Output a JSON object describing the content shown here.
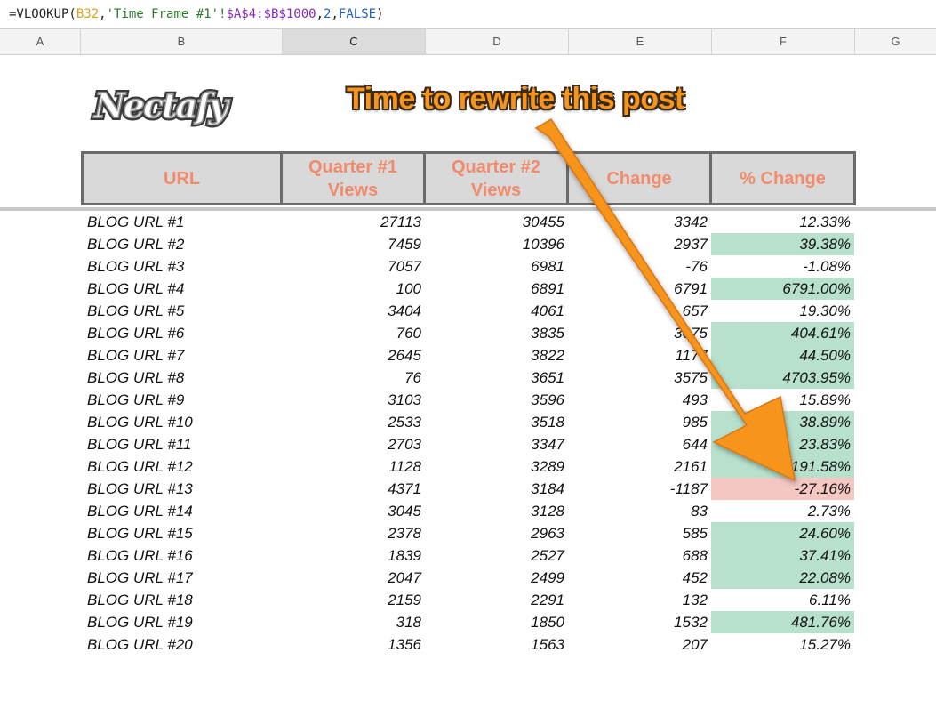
{
  "formula": {
    "prefix": "=VLOOKUP(",
    "ref": "B32",
    "comma1": ",",
    "sheet": "'Time Frame #1'!",
    "range": "$A$4:$B$1000",
    "comma2": ",",
    "index": "2",
    "comma3": ",",
    "flag": "FALSE",
    "suffix": ")"
  },
  "columns": [
    "A",
    "B",
    "C",
    "D",
    "E",
    "F",
    "G"
  ],
  "logo_text": "Nectafy",
  "annotation": "Time to rewrite this post",
  "colors": {
    "header_text": "#f28b6c",
    "positive": "#b7e1cd",
    "negative": "#f4c7c3",
    "arrow": "#f7941d"
  },
  "table": {
    "headers": [
      "URL",
      "Quarter #1 Views",
      "Quarter #2 Views",
      "Change",
      "% Change"
    ],
    "rows": [
      {
        "url": "BLOG URL #1",
        "q1": "27113",
        "q2": "30455",
        "change": "3342",
        "pct": "12.33%",
        "status": "none"
      },
      {
        "url": "BLOG URL #2",
        "q1": "7459",
        "q2": "10396",
        "change": "2937",
        "pct": "39.38%",
        "status": "positive"
      },
      {
        "url": "BLOG URL #3",
        "q1": "7057",
        "q2": "6981",
        "change": "-76",
        "pct": "-1.08%",
        "status": "none"
      },
      {
        "url": "BLOG URL #4",
        "q1": "100",
        "q2": "6891",
        "change": "6791",
        "pct": "6791.00%",
        "status": "positive"
      },
      {
        "url": "BLOG URL #5",
        "q1": "3404",
        "q2": "4061",
        "change": "657",
        "pct": "19.30%",
        "status": "none"
      },
      {
        "url": "BLOG URL #6",
        "q1": "760",
        "q2": "3835",
        "change": "3075",
        "pct": "404.61%",
        "status": "positive"
      },
      {
        "url": "BLOG URL #7",
        "q1": "2645",
        "q2": "3822",
        "change": "1177",
        "pct": "44.50%",
        "status": "positive"
      },
      {
        "url": "BLOG URL #8",
        "q1": "76",
        "q2": "3651",
        "change": "3575",
        "pct": "4703.95%",
        "status": "positive"
      },
      {
        "url": "BLOG URL #9",
        "q1": "3103",
        "q2": "3596",
        "change": "493",
        "pct": "15.89%",
        "status": "none"
      },
      {
        "url": "BLOG URL #10",
        "q1": "2533",
        "q2": "3518",
        "change": "985",
        "pct": "38.89%",
        "status": "positive"
      },
      {
        "url": "BLOG URL #11",
        "q1": "2703",
        "q2": "3347",
        "change": "644",
        "pct": "23.83%",
        "status": "positive"
      },
      {
        "url": "BLOG URL #12",
        "q1": "1128",
        "q2": "3289",
        "change": "2161",
        "pct": "191.58%",
        "status": "positive"
      },
      {
        "url": "BLOG URL #13",
        "q1": "4371",
        "q2": "3184",
        "change": "-1187",
        "pct": "-27.16%",
        "status": "negative"
      },
      {
        "url": "BLOG URL #14",
        "q1": "3045",
        "q2": "3128",
        "change": "83",
        "pct": "2.73%",
        "status": "none"
      },
      {
        "url": "BLOG URL #15",
        "q1": "2378",
        "q2": "2963",
        "change": "585",
        "pct": "24.60%",
        "status": "positive"
      },
      {
        "url": "BLOG URL #16",
        "q1": "1839",
        "q2": "2527",
        "change": "688",
        "pct": "37.41%",
        "status": "positive"
      },
      {
        "url": "BLOG URL #17",
        "q1": "2047",
        "q2": "2499",
        "change": "452",
        "pct": "22.08%",
        "status": "positive"
      },
      {
        "url": "BLOG URL #18",
        "q1": "2159",
        "q2": "2291",
        "change": "132",
        "pct": "6.11%",
        "status": "none"
      },
      {
        "url": "BLOG URL #19",
        "q1": "318",
        "q2": "1850",
        "change": "1532",
        "pct": "481.76%",
        "status": "positive"
      },
      {
        "url": "BLOG URL #20",
        "q1": "1356",
        "q2": "1563",
        "change": "207",
        "pct": "15.27%",
        "status": "none"
      }
    ]
  }
}
